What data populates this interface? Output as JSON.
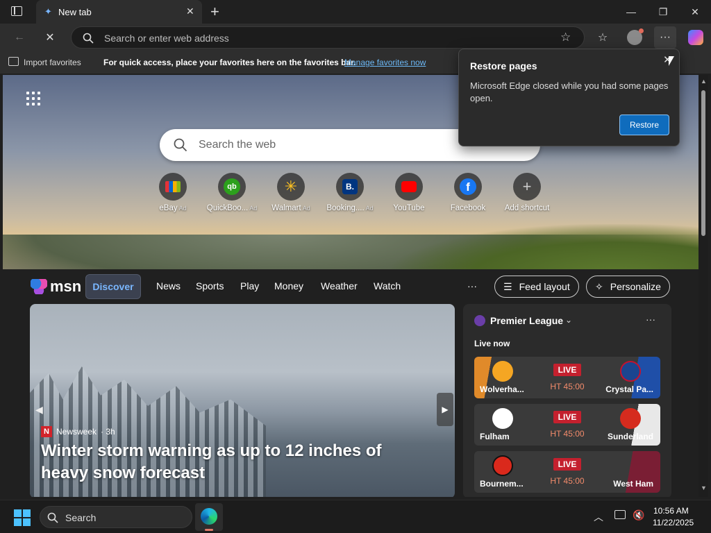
{
  "browser": {
    "tab_title": "New tab",
    "address_placeholder": "Search or enter web address",
    "favorites_bar": {
      "import_label": "Import favorites",
      "hint_text": "For quick access, place your favorites here on the favorites bar.",
      "manage_link": "Manage favorites now"
    }
  },
  "newtab": {
    "search_placeholder": "Search the web",
    "shortcuts": [
      {
        "label": "eBay",
        "ad": "Ad",
        "icon": "ebay-icon"
      },
      {
        "label": "QuickBoo...",
        "ad": "Ad",
        "icon": "quickbooks-icon"
      },
      {
        "label": "Walmart",
        "ad": "Ad",
        "icon": "walmart-icon"
      },
      {
        "label": "Booking....",
        "ad": "Ad",
        "icon": "booking-icon"
      },
      {
        "label": "YouTube",
        "ad": "",
        "icon": "youtube-icon"
      },
      {
        "label": "Facebook",
        "ad": "",
        "icon": "facebook-icon"
      },
      {
        "label": "Add shortcut",
        "ad": "",
        "icon": "plus-icon"
      }
    ]
  },
  "msn": {
    "logo_text": "msn",
    "nav": [
      "Discover",
      "News",
      "Sports",
      "Play",
      "Money",
      "Weather",
      "Watch"
    ],
    "more": "···",
    "feed_layout": "Feed layout",
    "personalize": "Personalize",
    "hero": {
      "source": "Newsweek",
      "age": "· 3h",
      "title": "Winter storm warning as up to 12 inches of heavy snow forecast"
    },
    "league": {
      "name": "Premier League",
      "live_now": "Live now",
      "more": "···",
      "matches": [
        {
          "home": "Wolverha...",
          "away": "Crystal Pa...",
          "status": "LIVE",
          "time": "HT 45:00"
        },
        {
          "home": "Fulham",
          "away": "Sunderland",
          "status": "LIVE",
          "time": "HT 45:00"
        },
        {
          "home": "Bournem...",
          "away": "West Ham",
          "status": "LIVE",
          "time": "HT 45:00"
        }
      ]
    }
  },
  "restore_popup": {
    "title": "Restore pages",
    "message": "Microsoft Edge closed while you had some pages open.",
    "button": "Restore"
  },
  "taskbar": {
    "search_label": "Search",
    "time": "10:56 AM",
    "date": "11/22/2025"
  },
  "colors": {
    "accent": "#0f6cbd",
    "live_red": "#c4202e",
    "link": "#6cb8f6"
  }
}
